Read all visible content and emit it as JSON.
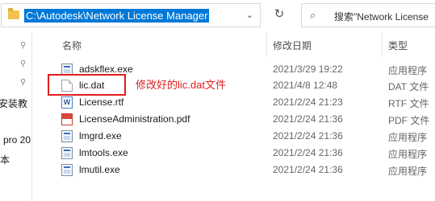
{
  "address": {
    "path": "C:\\Autodesk\\Network License Manager"
  },
  "search": {
    "placeholder": "搜索\"Network License"
  },
  "nav": {
    "items": [
      "安装教",
      "pro 20",
      "本"
    ]
  },
  "columns": {
    "name": "名称",
    "date": "修改日期",
    "type": "类型"
  },
  "files": [
    {
      "name": "adskflex.exe",
      "date": "2021/3/29 19:22",
      "type": "应用程序",
      "icon": "exe-icon"
    },
    {
      "name": "lic.dat",
      "date": "2021/4/8 12:48",
      "type": "DAT 文件",
      "icon": "dat-file-icon"
    },
    {
      "name": "License.rtf",
      "date": "2021/2/24 21:23",
      "type": "RTF 文件",
      "icon": "rtf-file-icon"
    },
    {
      "name": "LicenseAdministration.pdf",
      "date": "2021/2/24 21:36",
      "type": "PDF 文件",
      "icon": "pdf-file-icon"
    },
    {
      "name": "lmgrd.exe",
      "date": "2021/2/24 21:36",
      "type": "应用程序",
      "icon": "exe-icon"
    },
    {
      "name": "lmtools.exe",
      "date": "2021/2/24 21:36",
      "type": "应用程序",
      "icon": "exe-icon"
    },
    {
      "name": "lmutil.exe",
      "date": "2021/2/24 21:36",
      "type": "应用程序",
      "icon": "exe-icon"
    }
  ],
  "annotation": {
    "text": "修改好的lic.dat文件",
    "color": "#e01e1e"
  },
  "colors": {
    "selection": "#0078d7"
  }
}
